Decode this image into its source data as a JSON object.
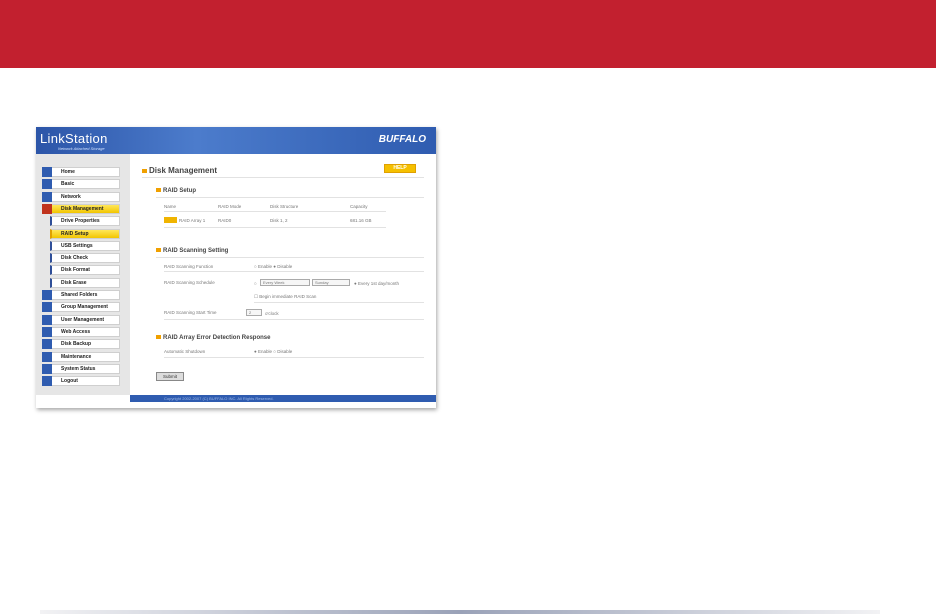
{
  "header": {
    "logo": "LinkStation",
    "tagline": "Network Attached Storage",
    "brand": "BUFFALO"
  },
  "sidebar": {
    "items": [
      {
        "label": "Home",
        "sub": false
      },
      {
        "label": "Basic",
        "sub": false
      },
      {
        "label": "Network",
        "sub": false
      },
      {
        "label": "Disk Management",
        "sub": false,
        "active": true
      },
      {
        "label": "Drive Properties",
        "sub": true
      },
      {
        "label": "RAID Setup",
        "sub": true,
        "active": true
      },
      {
        "label": "USB Settings",
        "sub": true
      },
      {
        "label": "Disk Check",
        "sub": true
      },
      {
        "label": "Disk Format",
        "sub": true
      },
      {
        "label": "Disk Erase",
        "sub": true
      },
      {
        "label": "Shared Folders",
        "sub": false
      },
      {
        "label": "Group Management",
        "sub": false
      },
      {
        "label": "User Management",
        "sub": false
      },
      {
        "label": "Web Access",
        "sub": false
      },
      {
        "label": "Disk Backup",
        "sub": false
      },
      {
        "label": "Maintenance",
        "sub": false
      },
      {
        "label": "System Status",
        "sub": false
      },
      {
        "label": "Logout",
        "sub": false
      }
    ]
  },
  "main": {
    "title": "Disk Management",
    "help": "HELP",
    "raid_setup": {
      "heading": "RAID Setup",
      "columns": [
        "Name",
        "RAID Mode",
        "Disk Structure",
        "Capacity"
      ],
      "row": {
        "name": "RAID Array 1",
        "mode": "RAID0",
        "structure": "Disk 1, 2",
        "capacity": "681.16 GB"
      }
    },
    "scan": {
      "heading": "RAID Scanning Setting",
      "function_label": "RAID Scanning Function",
      "enable": "Enable",
      "disable": "Disable",
      "schedule_label": "RAID Scanning Schedule",
      "freq": "Every Week",
      "day": "Sunday",
      "monthly": "Every 1st day/month",
      "immediate": "Begin immediate RAID Scan",
      "start_label": "RAID Scanning Start Time",
      "hour": "2",
      "oclock": "o'clock"
    },
    "error": {
      "heading": "RAID Array Error Detection Response",
      "label": "Automatic Shutdown",
      "enable": "Enable",
      "disable": "Disable"
    },
    "submit": "Submit"
  },
  "footer": "Copyright 2002-2007 (C) BUFFALO INC. All Rights Reserved."
}
